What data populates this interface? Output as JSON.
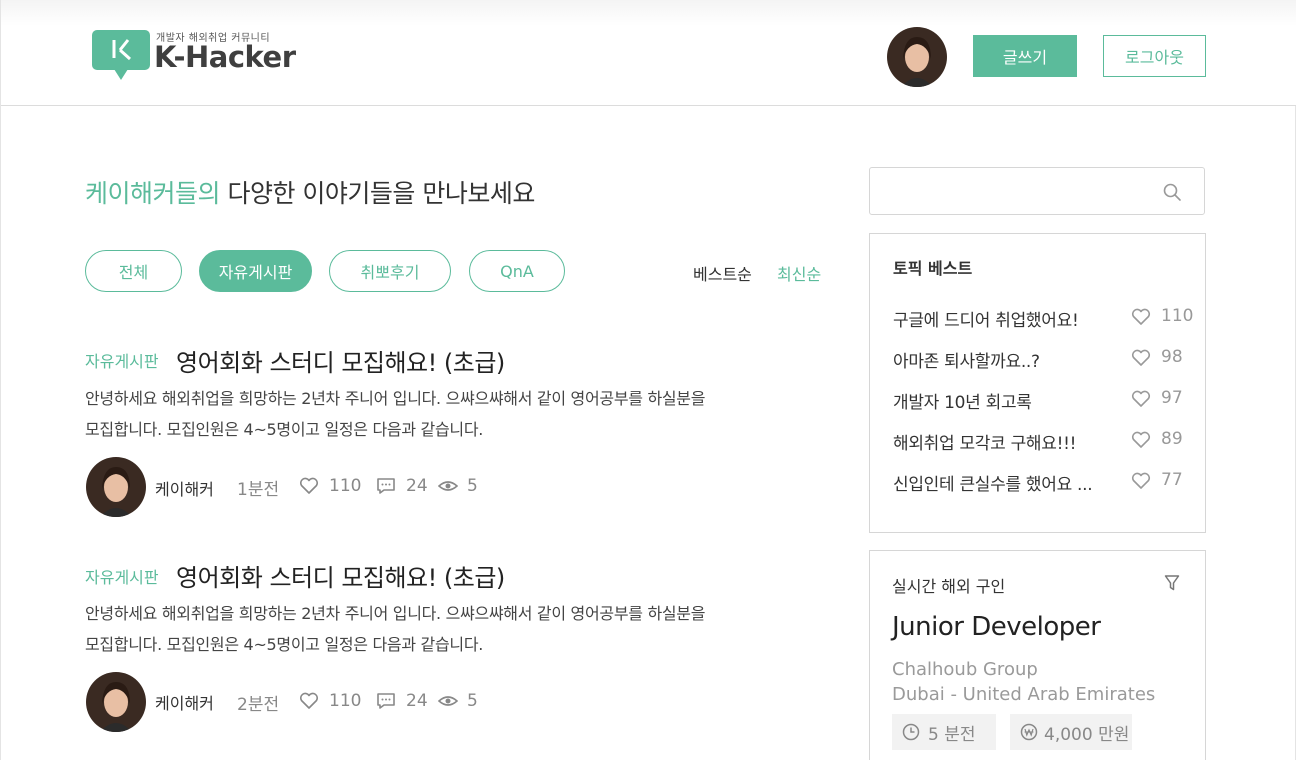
{
  "header": {
    "logo_tagline": "개발자 해외취업 커뮤니티",
    "logo_name": "K-Hacker",
    "write_label": "글쓰기",
    "logout_label": "로그아웃"
  },
  "headline": {
    "accent": "케이해커들의",
    "rest": " 다양한 이야기들을 만나보세요"
  },
  "filters": [
    {
      "label": "전체",
      "active": false
    },
    {
      "label": "자유게시판",
      "active": true
    },
    {
      "label": "취뽀후기",
      "active": false
    },
    {
      "label": "QnA",
      "active": false
    }
  ],
  "sort": {
    "best_label": "베스트순",
    "latest_label": "최신순",
    "selected": "최신순"
  },
  "posts": [
    {
      "category": "자유게시판",
      "title": "영어회화 스터디 모집해요! (초급)",
      "body_line1": "안녕하세요 해외취업을 희망하는 2년차 주니어 입니다.  으쌰으쌰해서 같이 영어공부를 하실분을",
      "body_line2": "모집합니다. 모집인원은 4~5명이고 일정은 다음과 같습니다.",
      "author": "케이해커",
      "time": "1분전",
      "likes": "110",
      "comments": "24",
      "views": "5"
    },
    {
      "category": "자유게시판",
      "title": "영어회화 스터디 모집해요! (초급)",
      "body_line1": "안녕하세요 해외취업을 희망하는 2년차 주니어 입니다.  으쌰으쌰해서 같이 영어공부를 하실분을",
      "body_line2": "모집합니다. 모집인원은 4~5명이고 일정은 다음과 같습니다.",
      "author": "케이해커",
      "time": "2분전",
      "likes": "110",
      "comments": "24",
      "views": "5"
    }
  ],
  "search": {
    "placeholder": ""
  },
  "topic_best": {
    "title": "토픽 베스트",
    "items": [
      {
        "label": "구글에 드디어 취업했어요!",
        "likes": "110"
      },
      {
        "label": "아마존 퇴사할까요..?",
        "likes": "98"
      },
      {
        "label": "개발자 10년 회고록",
        "likes": "97"
      },
      {
        "label": "해외취업 모각코 구해요!!!",
        "likes": "89"
      },
      {
        "label": "신입인테 큰실수를 했어요 ...",
        "likes": "77"
      }
    ]
  },
  "job": {
    "heading": "실시간 해외 구인",
    "title": "Junior Developer",
    "company": "Chalhoub Group",
    "location": "Dubai - United Arab Emirates",
    "posted": "5 분전",
    "salary": "4,000 만원"
  },
  "colors": {
    "accent": "#5bbb9b",
    "text": "#333333",
    "muted": "#888888",
    "border": "#d6d6d6"
  }
}
